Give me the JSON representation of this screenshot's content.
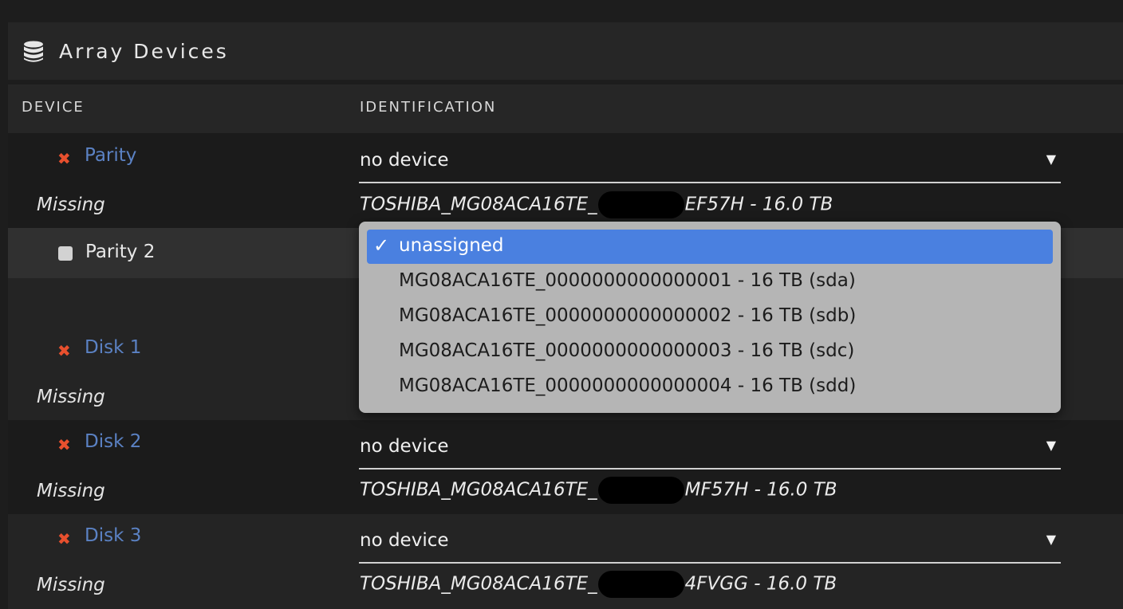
{
  "panel": {
    "title": "Array Devices",
    "icon": "database-icon",
    "columns": {
      "device": "DEVICE",
      "identification": "IDENTIFICATION"
    }
  },
  "colors": {
    "background": "#1d1d1d",
    "device_link": "#5b82c4",
    "error_x": "#e8502e",
    "dropdown_selected": "#4a80e0"
  },
  "devices": [
    {
      "name": "Parity",
      "status_icon": "x-icon",
      "status": "Missing",
      "select_value": "no device",
      "ident_prefix": "TOSHIBA_MG08ACA16TE_",
      "ident_suffix": "EF57H - 16.0 TB"
    },
    {
      "name": "Parity 2",
      "status_icon": "square-icon"
    },
    {
      "name": "Disk 1",
      "status_icon": "x-icon",
      "status": "Missing"
    },
    {
      "name": "Disk 2",
      "status_icon": "x-icon",
      "status": "Missing",
      "select_value": "no device",
      "ident_prefix": "TOSHIBA_MG08ACA16TE_",
      "ident_suffix": "MF57H - 16.0 TB"
    },
    {
      "name": "Disk 3",
      "status_icon": "x-icon",
      "status": "Missing",
      "select_value": "no device",
      "ident_prefix": "TOSHIBA_MG08ACA16TE_",
      "ident_suffix": "4FVGG - 16.0 TB"
    }
  ],
  "dropdown": {
    "check_glyph": "✓",
    "options": [
      "unassigned",
      "MG08ACA16TE_0000000000000001 - 16 TB (sda)",
      "MG08ACA16TE_0000000000000002 - 16 TB (sdb)",
      "MG08ACA16TE_0000000000000003 - 16 TB (sdc)",
      "MG08ACA16TE_0000000000000004 - 16 TB (sdd)"
    ],
    "selected": "unassigned"
  },
  "glyphs": {
    "x": "✖",
    "arrow": "▼"
  }
}
